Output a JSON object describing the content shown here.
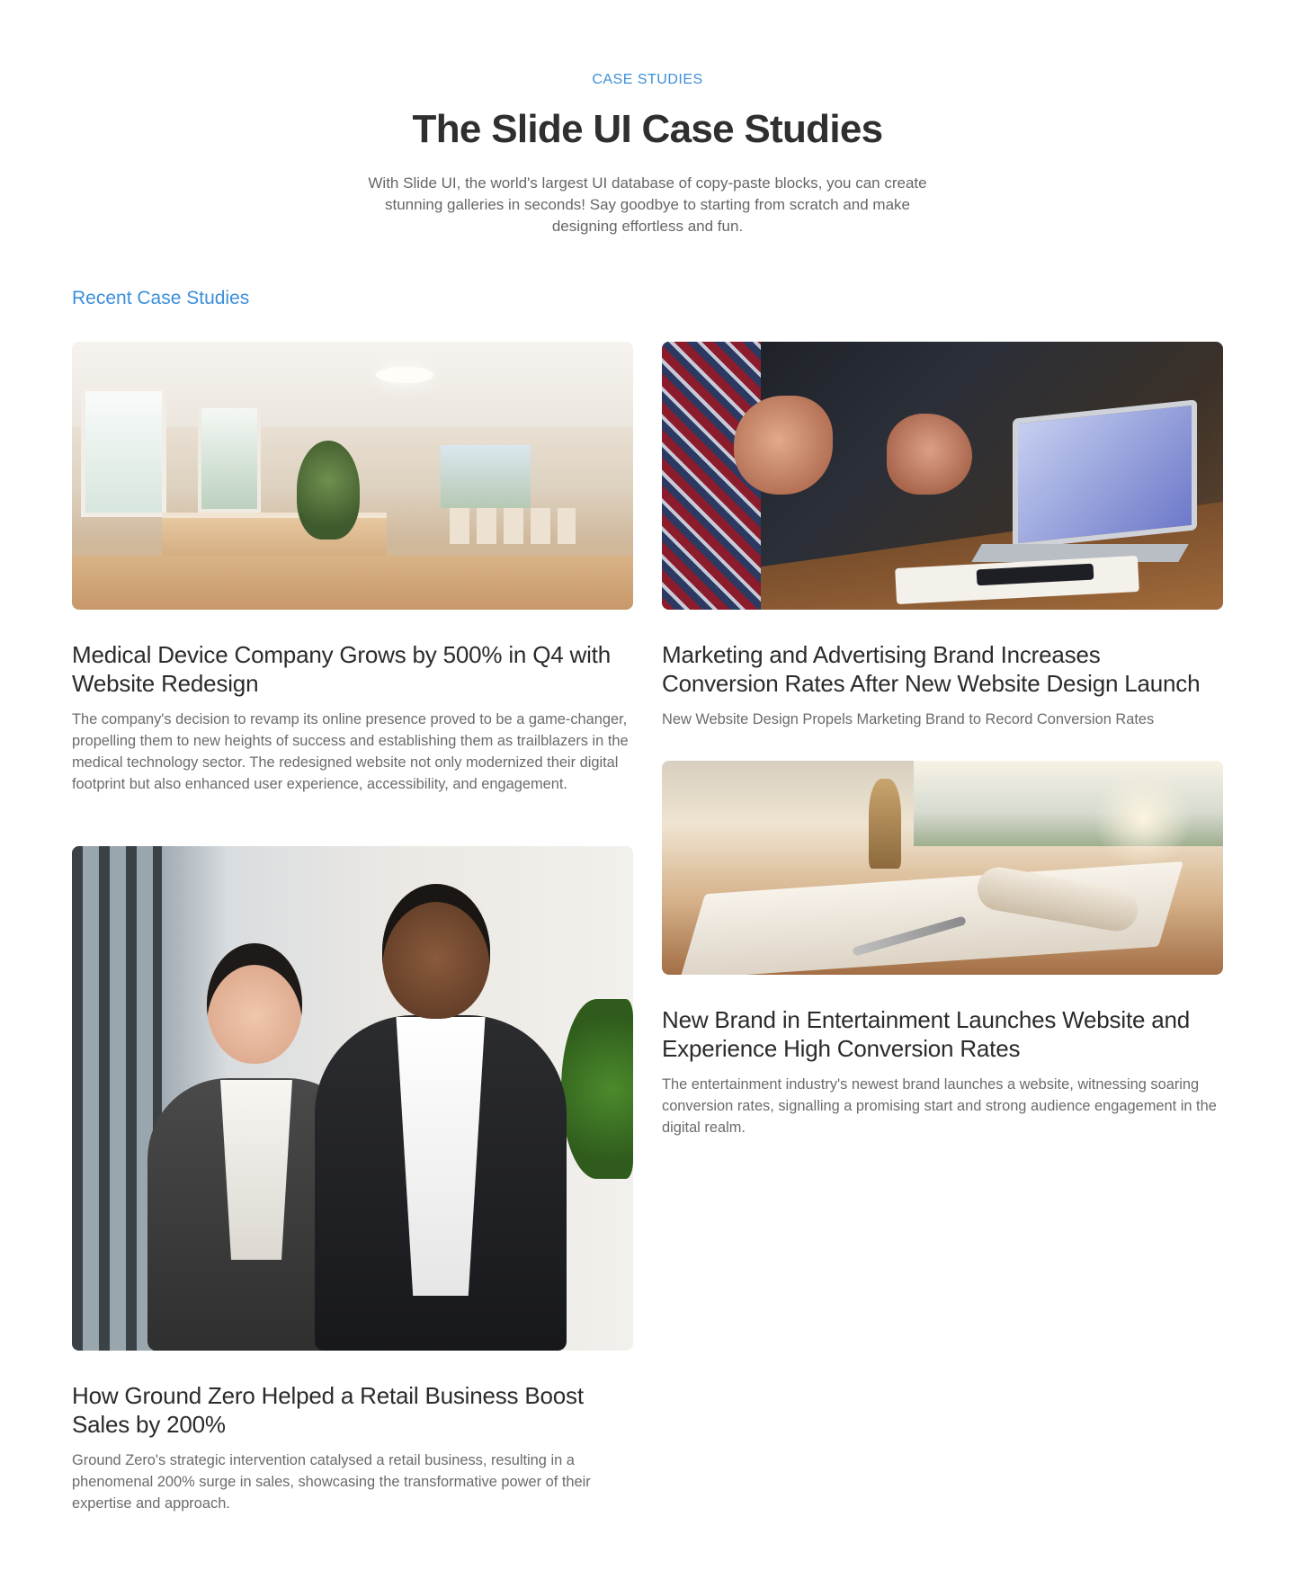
{
  "header": {
    "eyebrow": "CASE STUDIES",
    "title": "The Slide UI Case Studies",
    "subtitle": "With Slide UI, the world's largest UI database of copy-paste blocks, you can create stunning galleries in seconds! Say goodbye to starting from scratch and make designing effortless and fun."
  },
  "section": {
    "title": "Recent Case Studies"
  },
  "colors": {
    "accent": "#3b8fdb",
    "heading": "#2b2b2b",
    "body": "#6b6b6b"
  },
  "cards": [
    {
      "title": "Medical Device Company Grows by 500% in Q4 with Website Redesign",
      "description": "The company's decision to revamp its online presence proved to be a game-changer, propelling them to new heights of success and establishing them as trailblazers in the medical technology sector. The redesigned website not only modernized their digital footprint but also enhanced user experience, accessibility, and engagement."
    },
    {
      "title": "Marketing and Advertising Brand Increases Conversion Rates After New Website Design Launch",
      "description": "New Website Design Propels Marketing Brand to Record Conversion Rates"
    },
    {
      "title": "New Brand in Entertainment Launches Website and Experience High Conversion Rates",
      "description": "The entertainment industry's newest brand launches a website, witnessing soaring conversion rates, signalling a promising start and strong audience engagement in the digital realm."
    },
    {
      "title": "How Ground Zero Helped a Retail Business Boost Sales by 200%",
      "description": "Ground Zero's strategic intervention catalysed a retail business, resulting in a phenomenal 200% surge in sales, showcasing the transformative power of their expertise and approach."
    }
  ]
}
